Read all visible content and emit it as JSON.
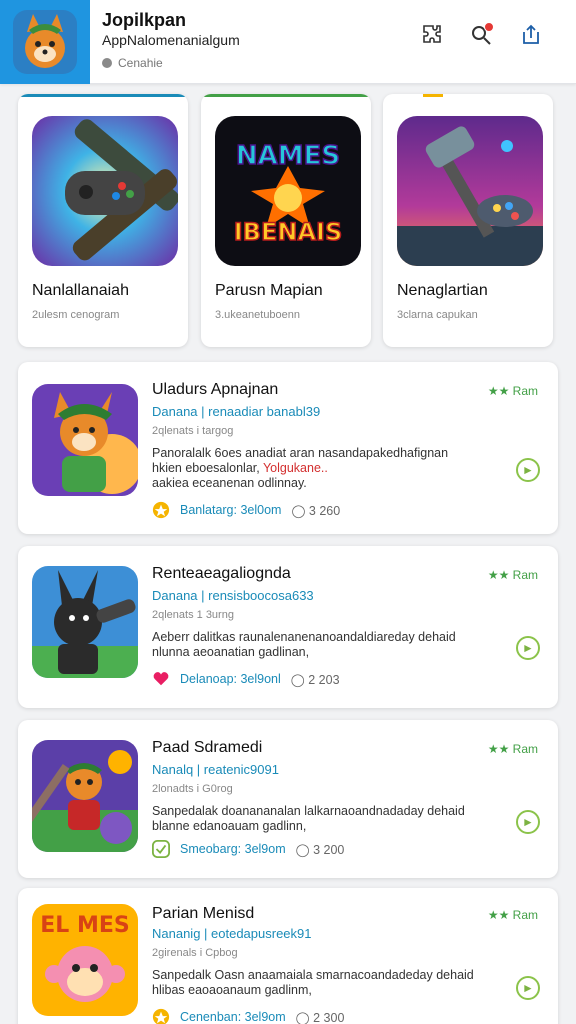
{
  "header": {
    "title": "Jopilkpan",
    "subtitle": "AppNalomenanialgum",
    "status": "Cenahie",
    "icons": [
      "puzzle-icon",
      "search-icon",
      "share-icon"
    ],
    "notification_color": "#e53935",
    "logo_color": "#1f95e0"
  },
  "featured": [
    {
      "name": "Nanlallanaiah",
      "sub": "2ulesm cenogram",
      "accent": "#1a8bb8",
      "icon": "controller-art-icon"
    },
    {
      "name": "Parusn Mapian",
      "sub": "3.ukeanetuboenn",
      "accent": "#43a047",
      "icon": "names-logo-art-icon",
      "art_text_top": "NAMES",
      "art_text_bottom": "IBENAIS"
    },
    {
      "name": "Nenaglartian",
      "sub": "3clarna capukan",
      "accent": "#f5b400",
      "icon": "hammer-art-icon"
    }
  ],
  "list": [
    {
      "title": "Uladurs Apnajnan",
      "meta": "Danana | renaadiar banabl39",
      "date": "2qlenats i targog",
      "desc_line1": "Panoralalk 6oes anadiat aran nasandapakedhafignan",
      "desc_line2_prefix": "hkien eboesalonlar,",
      "desc_line2_red": "Yolgukane..",
      "desc_line3": "aakiea eceanenan odlinnay.",
      "badge": "★★ Ram",
      "foot_label": "Banlatarg: 3el0om",
      "downloads": "3 260",
      "foot_icon": "star-badge-icon",
      "foot_icon_color": "#f5b400"
    },
    {
      "title": "Renteaeagaliognda",
      "meta": "Danana | rensisboocosa633",
      "date": "2qlenats 1 3urng",
      "desc_line1": "Aeberr dalitkas raunalenanenanoandaldiareday dehaid",
      "desc_line2_prefix": "nlunna aeoanatian gadlinan,",
      "desc_line2_red": "",
      "desc_line3": "",
      "badge": "★★ Ram",
      "foot_label": "Delanoap: 3el9onl",
      "downloads": "2 203",
      "foot_icon": "heart-badge-icon",
      "foot_icon_color": "#e91e63"
    },
    {
      "title": "Paad Sdramedi",
      "meta": "Nanalq | reatenic9091",
      "date": "2lonadts i G0rog",
      "desc_line1": "Sanpedalak doanananalan lalkarnaoandnadaday dehaid",
      "desc_line2_prefix": "blanne edanoauam gadlinn,",
      "desc_line2_red": "",
      "desc_line3": "",
      "badge": "★★ Ram",
      "foot_label": "Smeobarg: 3el9om",
      "downloads": "3 200",
      "foot_icon": "check-badge-icon",
      "foot_icon_color": "#7cb342"
    },
    {
      "title": "Parian Menisd",
      "meta": "Nananig | eotedapusreek91",
      "date": "2girenals i Cpbog",
      "desc_line1": "Sanpedalk Oasn anaamaiala smarnacoandadeday dehaid",
      "desc_line2_prefix": "hlibas eaoaoanaum gadlinm,",
      "desc_line2_red": "",
      "desc_line3": "",
      "badge": "★★ Ram",
      "foot_label": "Cenenban: 3el9om",
      "downloads": "2 300",
      "foot_icon": "star-badge-icon",
      "foot_icon_color": "#f5b400"
    }
  ]
}
